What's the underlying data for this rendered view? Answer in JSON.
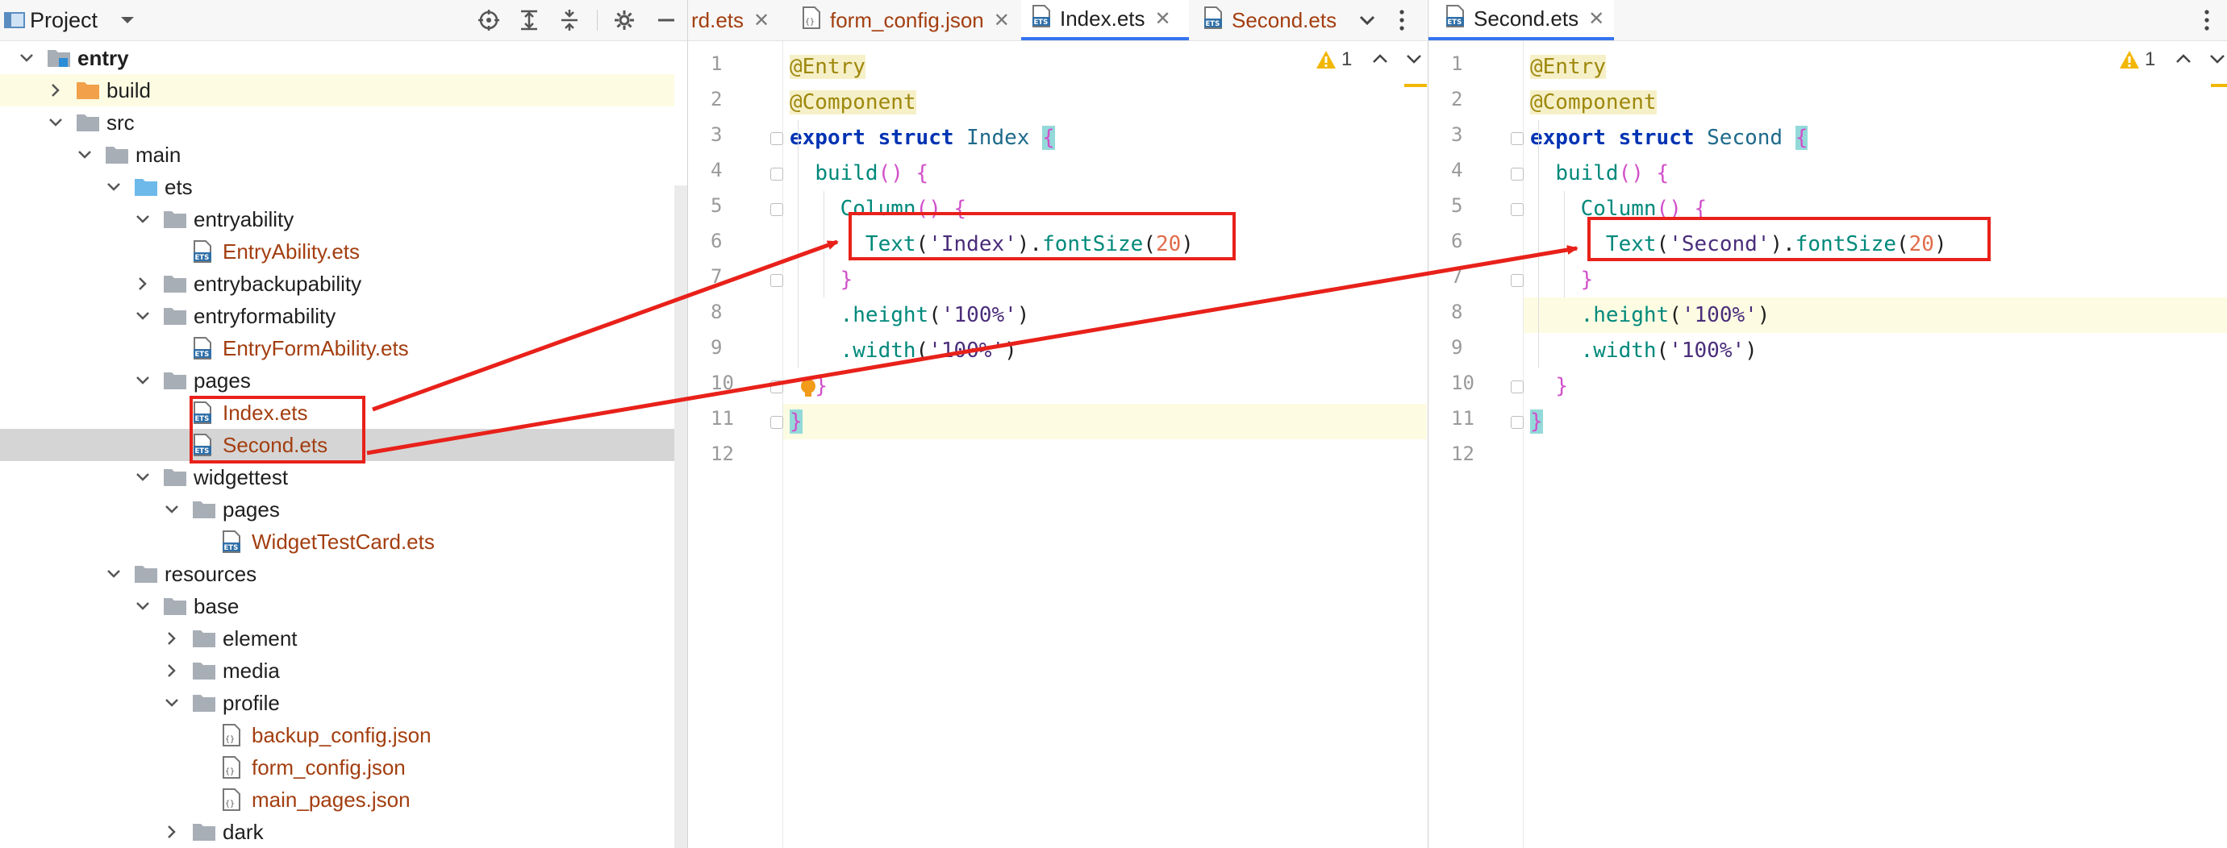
{
  "project": {
    "title": "Project",
    "header_icons": [
      "chevron-down-icon",
      "locate-icon",
      "expand-all-icon",
      "collapse-all-icon",
      "gear-icon",
      "minimize-icon"
    ],
    "tree": [
      {
        "label": "entry",
        "icon": "module-folder",
        "expanded": true,
        "bold": true
      },
      {
        "label": "build",
        "icon": "orange-folder",
        "expanded": false
      },
      {
        "label": "src",
        "icon": "folder",
        "expanded": true
      },
      {
        "label": "main",
        "icon": "folder",
        "expanded": true
      },
      {
        "label": "ets",
        "icon": "blue-folder",
        "expanded": true
      },
      {
        "label": "entryability",
        "icon": "folder",
        "expanded": true
      },
      {
        "label": "EntryAbility.ets",
        "icon": "ets-file"
      },
      {
        "label": "entrybackupability",
        "icon": "folder",
        "expanded": false
      },
      {
        "label": "entryformability",
        "icon": "folder",
        "expanded": true
      },
      {
        "label": "EntryFormAbility.ets",
        "icon": "ets-file"
      },
      {
        "label": "pages",
        "icon": "folder",
        "expanded": true
      },
      {
        "label": "Index.ets",
        "icon": "ets-file"
      },
      {
        "label": "Second.ets",
        "icon": "ets-file"
      },
      {
        "label": "widgettest",
        "icon": "folder",
        "expanded": true
      },
      {
        "label": "pages",
        "icon": "folder",
        "expanded": true
      },
      {
        "label": "WidgetTestCard.ets",
        "icon": "ets-file"
      },
      {
        "label": "resources",
        "icon": "folder",
        "expanded": true
      },
      {
        "label": "base",
        "icon": "folder",
        "expanded": true
      },
      {
        "label": "element",
        "icon": "folder",
        "expanded": false
      },
      {
        "label": "media",
        "icon": "folder",
        "expanded": false
      },
      {
        "label": "profile",
        "icon": "folder",
        "expanded": true
      },
      {
        "label": "backup_config.json",
        "icon": "json-file"
      },
      {
        "label": "form_config.json",
        "icon": "json-file"
      },
      {
        "label": "main_pages.json",
        "icon": "json-file"
      },
      {
        "label": "dark",
        "icon": "folder",
        "expanded": false
      }
    ]
  },
  "editor_left": {
    "tabs": [
      {
        "label": "rd.ets",
        "icon": "ets-file",
        "active": false
      },
      {
        "label": "form_config.json",
        "icon": "json-file",
        "active": false
      },
      {
        "label": "Index.ets",
        "icon": "ets-file",
        "active": true
      },
      {
        "label": "Second.ets",
        "icon": "ets-file",
        "active": false
      }
    ],
    "tab_menu_icons": [
      "chevron-down-icon",
      "more-icon"
    ],
    "warnings": "1",
    "line_numbers": [
      "1",
      "2",
      "3",
      "4",
      "5",
      "6",
      "7",
      "8",
      "9",
      "10",
      "11",
      "12"
    ],
    "code": {
      "l1": "@Entry",
      "l2": "@Component",
      "l3_kw1": "export",
      "l3_kw2": "struct",
      "l3_name": "Index",
      "l3_brace": "{",
      "l4_fn": "build",
      "l4_rest": "() {",
      "l5_fn": "Column",
      "l5_rest": "() {",
      "l6_fn": "Text",
      "l6_str": "'Index'",
      "l6_fn2": "fontSize",
      "l6_num": "20",
      "l7": "}",
      "l8_fn": ".height",
      "l8_str": "'100%'",
      "l9_fn": ".width",
      "l9_str": "'100%'",
      "l10": "}",
      "l11": "}"
    }
  },
  "editor_right": {
    "tabs": [
      {
        "label": "Second.ets",
        "icon": "ets-file",
        "active": true
      }
    ],
    "tab_menu_icons": [
      "more-icon"
    ],
    "warnings": "1",
    "line_numbers": [
      "1",
      "2",
      "3",
      "4",
      "5",
      "6",
      "7",
      "8",
      "9",
      "10",
      "11",
      "12"
    ],
    "code": {
      "l1": "@Entry",
      "l2": "@Component",
      "l3_kw1": "export",
      "l3_kw2": "struct",
      "l3_name": "Second",
      "l3_brace": "{",
      "l4_fn": "build",
      "l4_rest": "() {",
      "l5_fn": "Column",
      "l5_rest": "() {",
      "l6_fn": "Text",
      "l6_str": "'Second'",
      "l6_fn2": "fontSize",
      "l6_num": "20",
      "l7": "}",
      "l8_fn": ".height",
      "l8_str": "'100%'",
      "l9_fn": ".width",
      "l9_str": "'100%'",
      "l10": "}",
      "l11": "}"
    }
  },
  "annotation_colors": {
    "box": "#e8211a",
    "arrow": "#e8211a"
  }
}
